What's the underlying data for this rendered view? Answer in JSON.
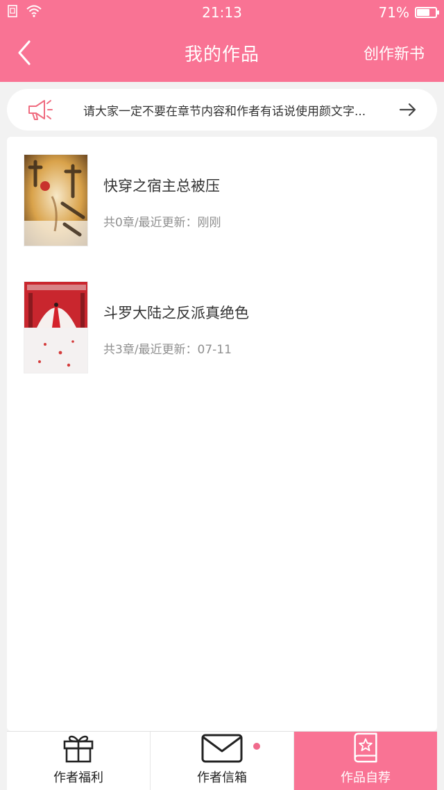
{
  "status_bar": {
    "time": "21:13",
    "battery": "71%",
    "battery_level": 0.71
  },
  "nav": {
    "title": "我的作品",
    "action": "创作新书"
  },
  "notice": {
    "text": "请大家一定不要在章节内容和作者有话说使用颜文字..."
  },
  "books": [
    {
      "title": "快穿之宿主总被压",
      "meta": "共0章/最近更新：刚刚"
    },
    {
      "title": "斗罗大陆之反派真绝色",
      "meta": "共3章/最近更新：07-11"
    }
  ],
  "tabs": [
    {
      "label": "作者福利",
      "icon": "gift-icon"
    },
    {
      "label": "作者信箱",
      "icon": "mail-icon"
    },
    {
      "label": "作品自荐",
      "icon": "book-star-icon"
    }
  ],
  "colors": {
    "accent": "#f97394",
    "badge": "#f06a8c"
  }
}
